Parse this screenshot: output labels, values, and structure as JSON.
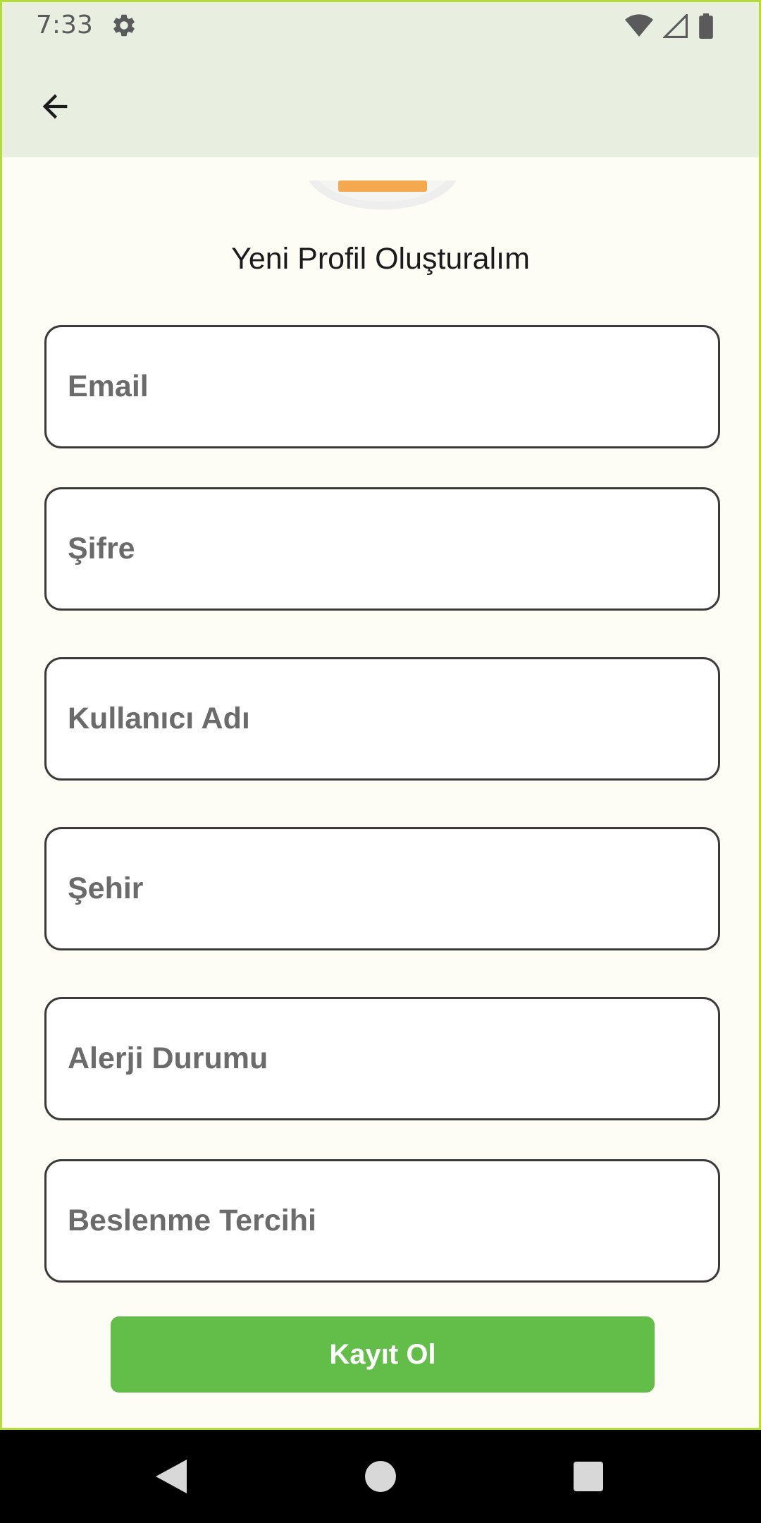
{
  "status_bar": {
    "time": "7:33",
    "icons": [
      "gear-icon",
      "wifi-icon",
      "signal-icon",
      "battery-icon"
    ]
  },
  "app_bar": {
    "back_icon": "arrow-back-icon"
  },
  "page": {
    "title": "Yeni Profil Oluşturalım"
  },
  "form": {
    "email_placeholder": "Email",
    "password_placeholder": "Şifre",
    "username_placeholder": "Kullanıcı Adı",
    "city_placeholder": "Şehir",
    "allergy_placeholder": "Alerji Durumu",
    "diet_placeholder": "Beslenme Tercihi",
    "submit_label": "Kayıt Ol"
  },
  "colors": {
    "accent": "#62be49",
    "header_bg": "#e8efe0",
    "page_bg": "#fdfdf6",
    "logo_orange": "#f5a94f",
    "frame_border": "#b5dc3c"
  },
  "nav_bar": {
    "buttons": [
      "back-triangle-icon",
      "home-circle-icon",
      "recents-square-icon"
    ]
  }
}
